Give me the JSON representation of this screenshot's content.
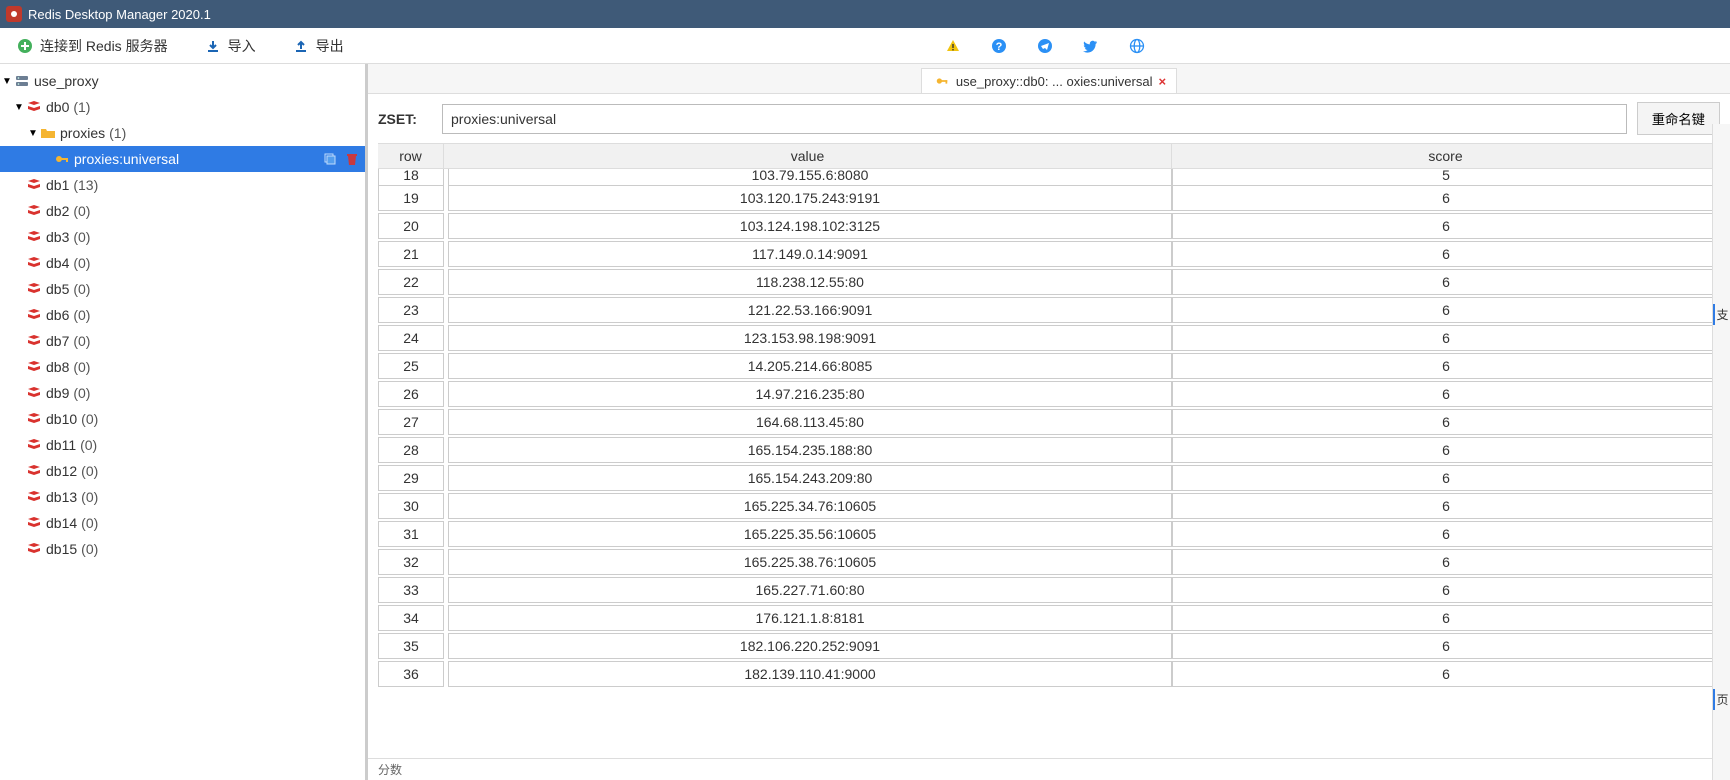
{
  "window": {
    "title": "Redis Desktop Manager 2020.1"
  },
  "toolbar": {
    "connect": "连接到 Redis 服务器",
    "import": "导入",
    "export": "导出"
  },
  "tree": {
    "connection": "use_proxy",
    "db0": {
      "name": "db0",
      "count": "(1)"
    },
    "folder": {
      "name": "proxies",
      "count": "(1)"
    },
    "key": "proxies:universal",
    "dbs": [
      {
        "name": "db1",
        "count": "(13)"
      },
      {
        "name": "db2",
        "count": "(0)"
      },
      {
        "name": "db3",
        "count": "(0)"
      },
      {
        "name": "db4",
        "count": "(0)"
      },
      {
        "name": "db5",
        "count": "(0)"
      },
      {
        "name": "db6",
        "count": "(0)"
      },
      {
        "name": "db7",
        "count": "(0)"
      },
      {
        "name": "db8",
        "count": "(0)"
      },
      {
        "name": "db9",
        "count": "(0)"
      },
      {
        "name": "db10",
        "count": "(0)"
      },
      {
        "name": "db11",
        "count": "(0)"
      },
      {
        "name": "db12",
        "count": "(0)"
      },
      {
        "name": "db13",
        "count": "(0)"
      },
      {
        "name": "db14",
        "count": "(0)"
      },
      {
        "name": "db15",
        "count": "(0)"
      }
    ]
  },
  "tab": {
    "label": "use_proxy::db0: ... oxies:universal"
  },
  "key": {
    "type": "ZSET:",
    "name": "proxies:universal",
    "rename": "重命名键"
  },
  "table": {
    "headers": {
      "row": "row",
      "value": "value",
      "score": "score"
    },
    "rows": [
      {
        "row": "18",
        "value": "103.79.155.6:8080",
        "score": "5",
        "cut": true
      },
      {
        "row": "19",
        "value": "103.120.175.243:9191",
        "score": "6"
      },
      {
        "row": "20",
        "value": "103.124.198.102:3125",
        "score": "6"
      },
      {
        "row": "21",
        "value": "117.149.0.14:9091",
        "score": "6"
      },
      {
        "row": "22",
        "value": "118.238.12.55:80",
        "score": "6"
      },
      {
        "row": "23",
        "value": "121.22.53.166:9091",
        "score": "6"
      },
      {
        "row": "24",
        "value": "123.153.98.198:9091",
        "score": "6"
      },
      {
        "row": "25",
        "value": "14.205.214.66:8085",
        "score": "6"
      },
      {
        "row": "26",
        "value": "14.97.216.235:80",
        "score": "6"
      },
      {
        "row": "27",
        "value": "164.68.113.45:80",
        "score": "6"
      },
      {
        "row": "28",
        "value": "165.154.235.188:80",
        "score": "6"
      },
      {
        "row": "29",
        "value": "165.154.243.209:80",
        "score": "6"
      },
      {
        "row": "30",
        "value": "165.225.34.76:10605",
        "score": "6"
      },
      {
        "row": "31",
        "value": "165.225.35.56:10605",
        "score": "6"
      },
      {
        "row": "32",
        "value": "165.225.38.76:10605",
        "score": "6"
      },
      {
        "row": "33",
        "value": "165.227.71.60:80",
        "score": "6"
      },
      {
        "row": "34",
        "value": "176.121.1.8:8181",
        "score": "6"
      },
      {
        "row": "35",
        "value": "182.106.220.252:9091",
        "score": "6"
      },
      {
        "row": "36",
        "value": "182.139.110.41:9000",
        "score": "6"
      }
    ]
  },
  "status": "分数",
  "side": {
    "top": "支",
    "bottom": "页"
  }
}
